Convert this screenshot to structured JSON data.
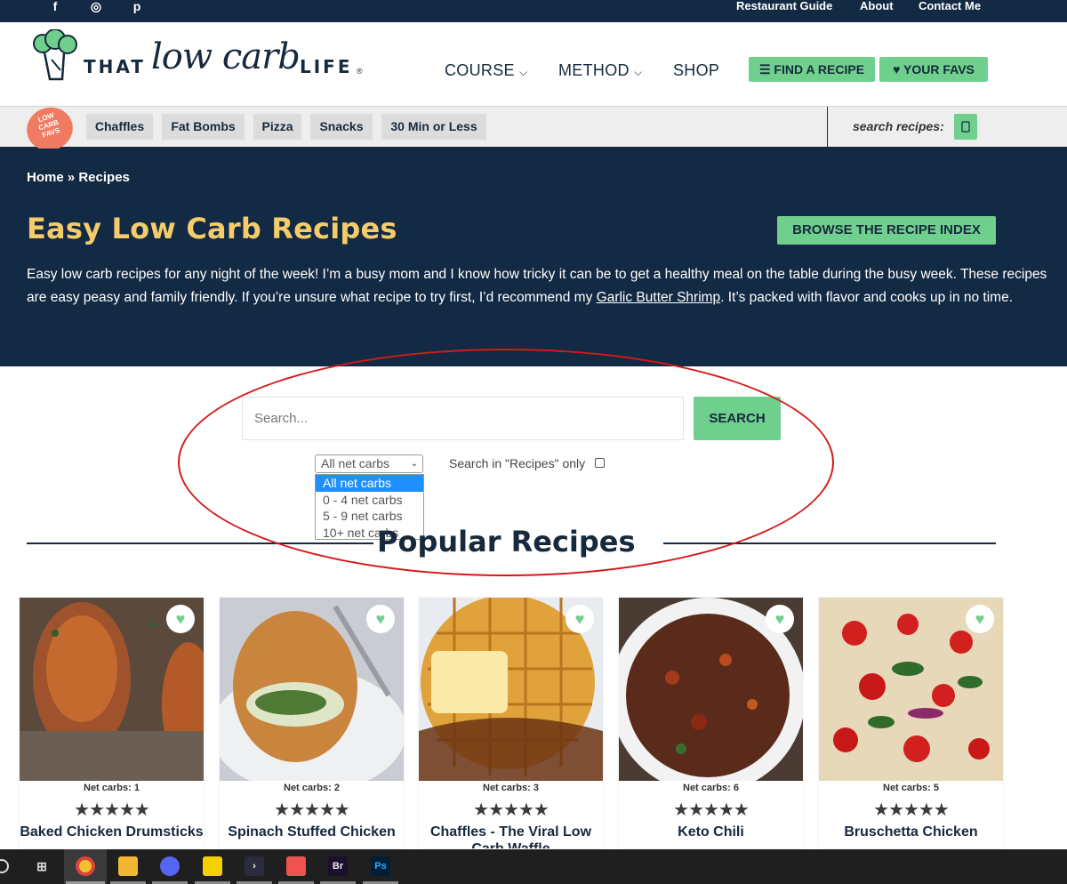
{
  "top_links": [
    "Restaurant Guide",
    "About",
    "Contact Me"
  ],
  "social": {
    "facebook": "f",
    "instagram": "◎",
    "pinterest": "p"
  },
  "logo": {
    "that": "THAT",
    "script": "low carb",
    "life": "LIFE",
    "reg": "®"
  },
  "nav": {
    "course": "COURSE",
    "method": "METHOD",
    "shop": "SHOP",
    "find_recipe": "FIND A RECIPE",
    "your_favs": "YOUR FAVS"
  },
  "fav_badge": {
    "line1": "LOW",
    "line2": "CARB",
    "line3": "FAVS"
  },
  "chips": [
    "Chaffles",
    "Fat Bombs",
    "Pizza",
    "Snacks",
    "30 Min or Less"
  ],
  "search_recipes_label": "search recipes:",
  "hero": {
    "breadcrumb": "Home » Recipes",
    "title": "Easy Low Carb Recipes",
    "browse_button": "BROWSE THE RECIPE INDEX",
    "text_before": "Easy low carb recipes for any night of the week! I’m a busy mom and I know how tricky it can be to get a healthy meal on the table during the busy week. These recipes are easy peasy and family friendly. If you’re unsure what recipe to try first, I’d recommend my ",
    "link": "Garlic Butter Shrimp",
    "text_after": ". It’s packed with flavor and cooks up in no time."
  },
  "search": {
    "placeholder": "Search...",
    "button": "SEARCH",
    "select_value": "All net carbs",
    "options": [
      "All net carbs",
      "0 - 4 net carbs",
      "5 - 9 net carbs",
      "10+ net carbs"
    ],
    "only_label": "Search in \"Recipes\" only"
  },
  "popular_title": "Popular Recipes",
  "cards": [
    {
      "carbs": "Net carbs: 1",
      "stars": "★★★★★",
      "title": "Baked Chicken Drumsticks"
    },
    {
      "carbs": "Net carbs: 2",
      "stars": "★★★★★",
      "title": "Spinach Stuffed Chicken"
    },
    {
      "carbs": "Net carbs: 3",
      "stars": "★★★★★",
      "title": "Chaffles - The Viral Low Carb Waffle"
    },
    {
      "carbs": "Net carbs: 6",
      "stars": "★★★★★",
      "title": "Keto Chili"
    },
    {
      "carbs": "Net carbs: 5",
      "stars": "★★★★★",
      "title": "Bruschetta Chicken"
    }
  ],
  "taskbar": {
    "br": "Br",
    "ps": "Ps"
  },
  "colors": {
    "navy": "#132a44",
    "green": "#6fcf8c",
    "gold": "#f4cc6b",
    "coral": "#f07a62",
    "annotation": "#d31818"
  }
}
